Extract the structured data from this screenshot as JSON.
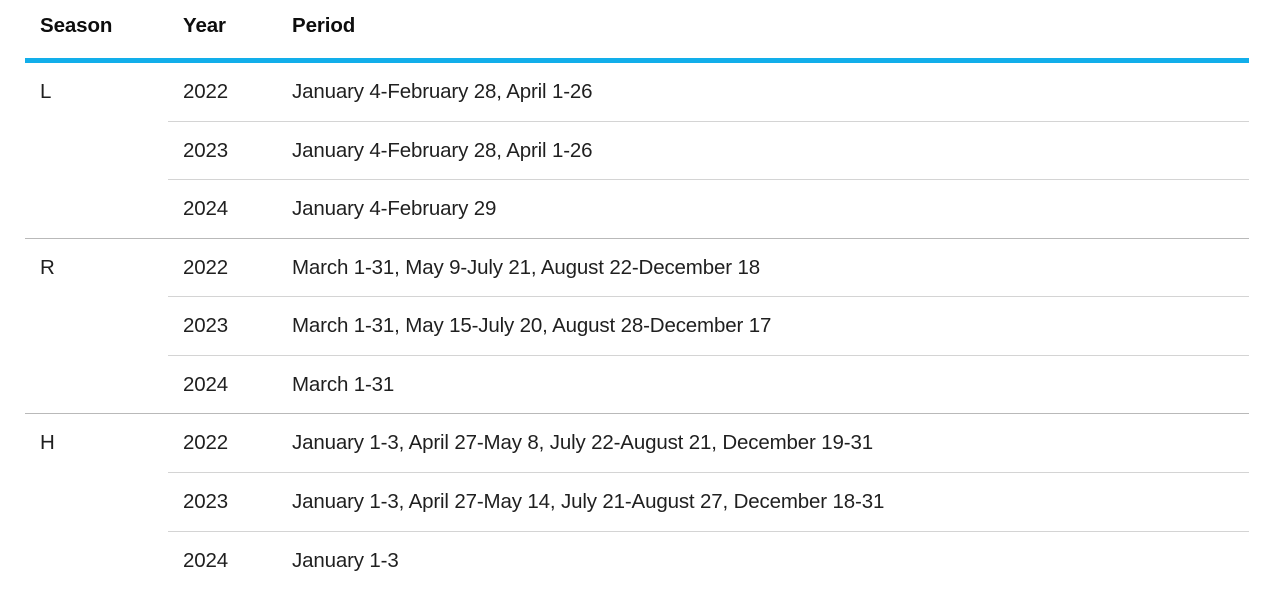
{
  "table": {
    "accent_color": "#12aeea",
    "columns": [
      {
        "key": "season",
        "label": "Season"
      },
      {
        "key": "year",
        "label": "Year"
      },
      {
        "key": "period",
        "label": "Period"
      }
    ],
    "groups": [
      {
        "season": "L",
        "rows": [
          {
            "year": "2022",
            "period": "January 4-February 28, April 1-26"
          },
          {
            "year": "2023",
            "period": "January 4-February 28, April 1-26"
          },
          {
            "year": "2024",
            "period": "January 4-February 29"
          }
        ]
      },
      {
        "season": "R",
        "rows": [
          {
            "year": "2022",
            "period": "March 1-31, May 9-July 21, August 22-December 18"
          },
          {
            "year": "2023",
            "period": "March 1-31, May 15-July 20, August 28-December 17"
          },
          {
            "year": "2024",
            "period": "March 1-31"
          }
        ]
      },
      {
        "season": "H",
        "rows": [
          {
            "year": "2022",
            "period": "January 1-3, April 27-May 8, July 22-August 21, December 19-31"
          },
          {
            "year": "2023",
            "period": "January 1-3, April 27-May 14, July 21-August 27, December 18-31"
          },
          {
            "year": "2024",
            "period": "January 1-3"
          }
        ]
      }
    ]
  }
}
